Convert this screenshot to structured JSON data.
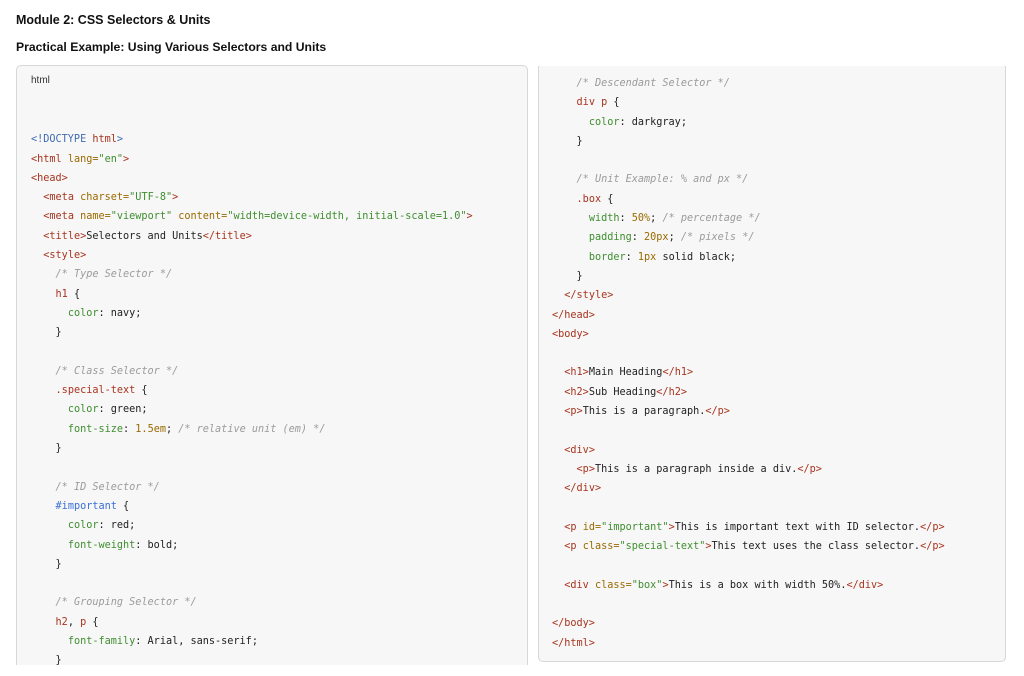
{
  "page": {
    "title": "Module 2: CSS Selectors & Units",
    "subtitle": "Practical Example: Using Various Selectors and Units"
  },
  "code_block": {
    "language_label": "html",
    "left_lines": [
      [],
      [
        [
          "doc",
          "<!DOCTYPE "
        ],
        [
          "kw",
          "html"
        ],
        [
          "doc",
          ">"
        ]
      ],
      [
        [
          "tag",
          "<html "
        ],
        [
          "attr",
          "lang="
        ],
        [
          "str",
          "\"en\""
        ],
        [
          "tag",
          ">"
        ]
      ],
      [
        [
          "tag",
          "<head>"
        ]
      ],
      [
        [
          "plain",
          "  "
        ],
        [
          "tag",
          "<meta "
        ],
        [
          "attr",
          "charset="
        ],
        [
          "str",
          "\"UTF-8\""
        ],
        [
          "tag",
          ">"
        ]
      ],
      [
        [
          "plain",
          "  "
        ],
        [
          "tag",
          "<meta "
        ],
        [
          "attr",
          "name="
        ],
        [
          "str",
          "\"viewport\""
        ],
        [
          "plain",
          " "
        ],
        [
          "attr",
          "content="
        ],
        [
          "str",
          "\"width=device-width, initial-scale=1.0\""
        ],
        [
          "tag",
          ">"
        ]
      ],
      [
        [
          "plain",
          "  "
        ],
        [
          "tag",
          "<title>"
        ],
        [
          "plain",
          "Selectors and Units"
        ],
        [
          "tag",
          "</title>"
        ]
      ],
      [
        [
          "plain",
          "  "
        ],
        [
          "tag",
          "<style>"
        ]
      ],
      [
        [
          "plain",
          "    "
        ],
        [
          "cmt",
          "/* Type Selector */"
        ]
      ],
      [
        [
          "plain",
          "    "
        ],
        [
          "sel",
          "h1"
        ],
        [
          "plain",
          " {"
        ]
      ],
      [
        [
          "plain",
          "      "
        ],
        [
          "prop",
          "color"
        ],
        [
          "plain",
          ": navy;"
        ]
      ],
      [
        [
          "plain",
          "    }"
        ]
      ],
      [],
      [
        [
          "plain",
          "    "
        ],
        [
          "cmt",
          "/* Class Selector */"
        ]
      ],
      [
        [
          "plain",
          "    "
        ],
        [
          "sel",
          ".special-text"
        ],
        [
          "plain",
          " {"
        ]
      ],
      [
        [
          "plain",
          "      "
        ],
        [
          "prop",
          "color"
        ],
        [
          "plain",
          ": green;"
        ]
      ],
      [
        [
          "plain",
          "      "
        ],
        [
          "prop",
          "font-size"
        ],
        [
          "plain",
          ": "
        ],
        [
          "num",
          "1.5em"
        ],
        [
          "plain",
          "; "
        ],
        [
          "cmt",
          "/* relative unit (em) */"
        ]
      ],
      [
        [
          "plain",
          "    }"
        ]
      ],
      [],
      [
        [
          "plain",
          "    "
        ],
        [
          "cmt",
          "/* ID Selector */"
        ]
      ],
      [
        [
          "plain",
          "    "
        ],
        [
          "id",
          "#important"
        ],
        [
          "plain",
          " {"
        ]
      ],
      [
        [
          "plain",
          "      "
        ],
        [
          "prop",
          "color"
        ],
        [
          "plain",
          ": red;"
        ]
      ],
      [
        [
          "plain",
          "      "
        ],
        [
          "prop",
          "font-weight"
        ],
        [
          "plain",
          ": bold;"
        ]
      ],
      [
        [
          "plain",
          "    }"
        ]
      ],
      [],
      [
        [
          "plain",
          "    "
        ],
        [
          "cmt",
          "/* Grouping Selector */"
        ]
      ],
      [
        [
          "plain",
          "    "
        ],
        [
          "sel",
          "h2"
        ],
        [
          "plain",
          ", "
        ],
        [
          "sel",
          "p"
        ],
        [
          "plain",
          " {"
        ]
      ],
      [
        [
          "plain",
          "      "
        ],
        [
          "prop",
          "font-family"
        ],
        [
          "plain",
          ": Arial, sans-serif;"
        ]
      ],
      [
        [
          "plain",
          "    }"
        ]
      ]
    ],
    "right_lines": [
      [
        [
          "plain",
          "    "
        ],
        [
          "cmt",
          "/* Descendant Selector */"
        ]
      ],
      [
        [
          "plain",
          "    "
        ],
        [
          "sel",
          "div p"
        ],
        [
          "plain",
          " {"
        ]
      ],
      [
        [
          "plain",
          "      "
        ],
        [
          "prop",
          "color"
        ],
        [
          "plain",
          ": darkgray;"
        ]
      ],
      [
        [
          "plain",
          "    }"
        ]
      ],
      [],
      [
        [
          "plain",
          "    "
        ],
        [
          "cmt",
          "/* Unit Example: % and px */"
        ]
      ],
      [
        [
          "plain",
          "    "
        ],
        [
          "sel",
          ".box"
        ],
        [
          "plain",
          " {"
        ]
      ],
      [
        [
          "plain",
          "      "
        ],
        [
          "prop",
          "width"
        ],
        [
          "plain",
          ": "
        ],
        [
          "num",
          "50%"
        ],
        [
          "plain",
          "; "
        ],
        [
          "cmt",
          "/* percentage */"
        ]
      ],
      [
        [
          "plain",
          "      "
        ],
        [
          "prop",
          "padding"
        ],
        [
          "plain",
          ": "
        ],
        [
          "num",
          "20px"
        ],
        [
          "plain",
          "; "
        ],
        [
          "cmt",
          "/* pixels */"
        ]
      ],
      [
        [
          "plain",
          "      "
        ],
        [
          "prop",
          "border"
        ],
        [
          "plain",
          ": "
        ],
        [
          "num",
          "1px"
        ],
        [
          "plain",
          " solid black;"
        ]
      ],
      [
        [
          "plain",
          "    }"
        ]
      ],
      [
        [
          "plain",
          "  "
        ],
        [
          "tag",
          "</style>"
        ]
      ],
      [
        [
          "tag",
          "</head>"
        ]
      ],
      [
        [
          "tag",
          "<body>"
        ]
      ],
      [],
      [
        [
          "plain",
          "  "
        ],
        [
          "tag",
          "<h1>"
        ],
        [
          "plain",
          "Main Heading"
        ],
        [
          "tag",
          "</h1>"
        ]
      ],
      [
        [
          "plain",
          "  "
        ],
        [
          "tag",
          "<h2>"
        ],
        [
          "plain",
          "Sub Heading"
        ],
        [
          "tag",
          "</h2>"
        ]
      ],
      [
        [
          "plain",
          "  "
        ],
        [
          "tag",
          "<p>"
        ],
        [
          "plain",
          "This is a paragraph."
        ],
        [
          "tag",
          "</p>"
        ]
      ],
      [],
      [
        [
          "plain",
          "  "
        ],
        [
          "tag",
          "<div>"
        ]
      ],
      [
        [
          "plain",
          "    "
        ],
        [
          "tag",
          "<p>"
        ],
        [
          "plain",
          "This is a paragraph inside a div."
        ],
        [
          "tag",
          "</p>"
        ]
      ],
      [
        [
          "plain",
          "  "
        ],
        [
          "tag",
          "</div>"
        ]
      ],
      [],
      [
        [
          "plain",
          "  "
        ],
        [
          "tag",
          "<p "
        ],
        [
          "attr",
          "id="
        ],
        [
          "str",
          "\"important\""
        ],
        [
          "tag",
          ">"
        ],
        [
          "plain",
          "This is important text with ID selector."
        ],
        [
          "tag",
          "</p>"
        ]
      ],
      [
        [
          "plain",
          "  "
        ],
        [
          "tag",
          "<p "
        ],
        [
          "attr",
          "class="
        ],
        [
          "str",
          "\"special-text\""
        ],
        [
          "tag",
          ">"
        ],
        [
          "plain",
          "This text uses the class selector."
        ],
        [
          "tag",
          "</p>"
        ]
      ],
      [],
      [
        [
          "plain",
          "  "
        ],
        [
          "tag",
          "<div "
        ],
        [
          "attr",
          "class="
        ],
        [
          "str",
          "\"box\""
        ],
        [
          "tag",
          ">"
        ],
        [
          "plain",
          "This is a box with width 50%."
        ],
        [
          "tag",
          "</div>"
        ]
      ],
      [],
      [
        [
          "tag",
          "</body>"
        ]
      ],
      [
        [
          "tag",
          "</html>"
        ]
      ]
    ]
  }
}
